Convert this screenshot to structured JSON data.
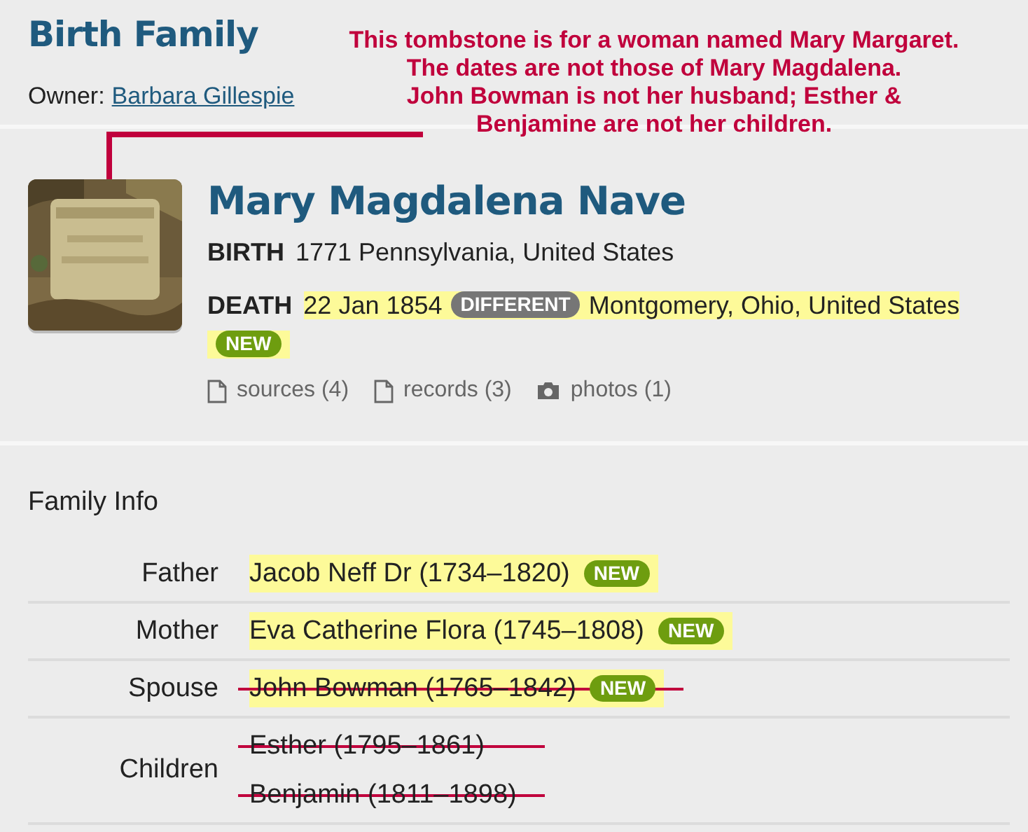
{
  "header": {
    "title": "Birth Family",
    "owner_label": "Owner:",
    "owner_name": "Barbara Gillespie"
  },
  "annotation": {
    "lines": [
      "This tombstone is for a woman named Mary Margaret.",
      "The dates are not those of Mary Magdalena.",
      "John Bowman is not her husband; Esther &",
      "Benjamine are not her children."
    ]
  },
  "person": {
    "name": "Mary Magdalena Nave",
    "birth": {
      "label": "BIRTH",
      "value": "1771 Pennsylvania, United States"
    },
    "death": {
      "label": "DEATH",
      "date": "22 Jan 1854",
      "date_badge": {
        "kind": "different",
        "text": "DIFFERENT"
      },
      "place": "Montgomery, Ohio, United States",
      "place_badge": {
        "kind": "new",
        "text": "NEW"
      },
      "highlighted": true
    },
    "links": [
      {
        "kind": "document",
        "text": "sources (4)"
      },
      {
        "kind": "document",
        "text": "records (3)"
      },
      {
        "kind": "camera",
        "text": "photos (1)"
      }
    ]
  },
  "family_info": {
    "title": "Family Info",
    "rows": [
      {
        "label": "Father",
        "people": [
          {
            "text": "Jacob Neff Dr (1734–1820)",
            "highlighted": true,
            "struck": false,
            "badge": {
              "kind": "new",
              "text": "NEW"
            }
          }
        ]
      },
      {
        "label": "Mother",
        "people": [
          {
            "text": "Eva Catherine Flora (1745–1808)",
            "highlighted": true,
            "struck": false,
            "badge": {
              "kind": "new",
              "text": "NEW"
            }
          }
        ]
      },
      {
        "label": "Spouse",
        "people": [
          {
            "text": "John Bowman (1765–1842)",
            "highlighted": true,
            "struck": true,
            "badge": {
              "kind": "new",
              "text": "NEW"
            }
          }
        ]
      },
      {
        "label": "Children",
        "people": [
          {
            "text": "Esther (1795–1861)",
            "highlighted": false,
            "struck": true
          },
          {
            "text": "Benjamin (1811–1898)",
            "highlighted": false,
            "struck": true
          }
        ]
      }
    ]
  }
}
